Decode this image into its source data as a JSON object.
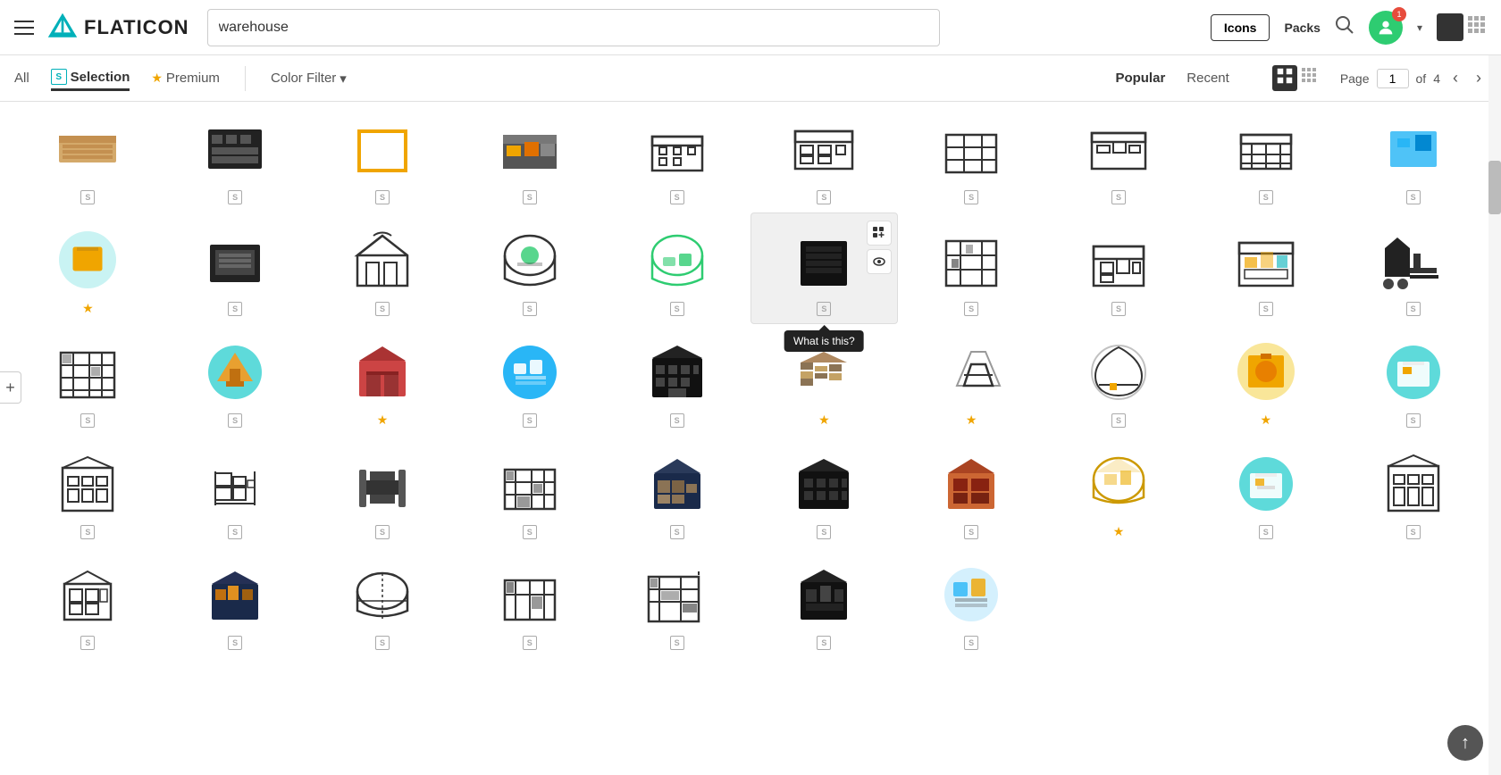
{
  "header": {
    "search_placeholder": "warehouse",
    "search_value": "warehouse",
    "btn_icons": "Icons",
    "btn_packs": "Packs",
    "notification_count": "1",
    "page_title": "FLATICON"
  },
  "subheader": {
    "tab_all": "All",
    "tab_selection": "Selection",
    "tab_premium": "Premium",
    "tab_color_filter": "Color Filter",
    "tab_popular": "Popular",
    "tab_recent": "Recent",
    "page_label": "Page",
    "page_current": "1",
    "page_total": "4",
    "of_label": "of"
  },
  "tooltip": {
    "text": "What is this?"
  },
  "add_btn": "+",
  "back_to_top": "↑",
  "icons": {
    "rows": [
      [
        {
          "type": "color",
          "premium": false,
          "s": false
        },
        {
          "type": "color",
          "premium": false,
          "s": false
        },
        {
          "type": "color",
          "premium": false,
          "s": false
        },
        {
          "type": "color",
          "premium": false,
          "s": false
        },
        {
          "type": "color",
          "premium": false,
          "s": false
        },
        {
          "type": "color",
          "premium": false,
          "s": false
        },
        {
          "type": "color",
          "premium": false,
          "s": false
        },
        {
          "type": "color",
          "premium": false,
          "s": false
        },
        {
          "type": "color",
          "premium": false,
          "s": false
        },
        {
          "type": "color",
          "premium": false,
          "s": false
        }
      ],
      [
        {
          "badge": "s-teal"
        },
        {
          "badge": "s-teal"
        },
        {
          "badge": "s-teal"
        },
        {
          "badge": "s-teal"
        },
        {
          "badge": "s-teal"
        },
        {
          "badge": "s-teal",
          "hovered": true,
          "tooltip": true
        },
        {
          "badge": "s-teal"
        },
        {
          "badge": "s-teal"
        },
        {
          "badge": "s-teal"
        },
        {
          "badge": "s-teal"
        }
      ]
    ]
  }
}
